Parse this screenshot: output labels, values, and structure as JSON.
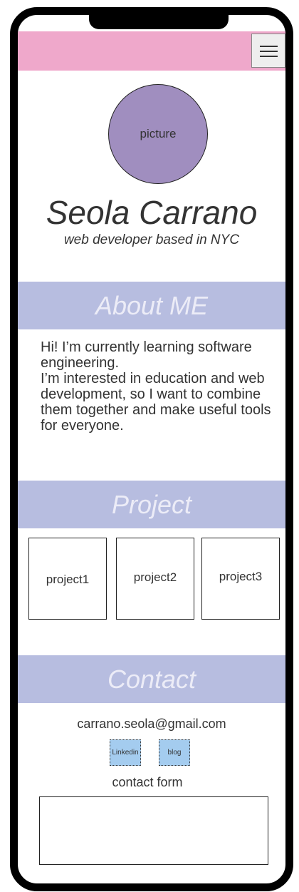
{
  "profile": {
    "picture_label": "picture",
    "name": "Seola Carrano",
    "tagline": "web developer based in NYC"
  },
  "about": {
    "heading": "About ME",
    "paragraphs": [
      "Hi! I’m currently learning software engineering.",
      "I’m interested in education and web development, so I want to combine them together and make useful tools for everyone."
    ]
  },
  "projects": {
    "heading": "Project",
    "items": [
      "project1",
      "project2",
      "project3"
    ]
  },
  "contact": {
    "heading": "Contact",
    "email": "carrano.seola@gmail.com",
    "links": [
      "Linkedin",
      "blog"
    ],
    "form_label": "contact form"
  },
  "colors": {
    "topbar": "#efa8cb",
    "avatar": "#a08ebf",
    "section_header": "#b7bde0",
    "link_button": "#a4ccef"
  },
  "icons": {
    "menu": "hamburger-menu-icon"
  }
}
